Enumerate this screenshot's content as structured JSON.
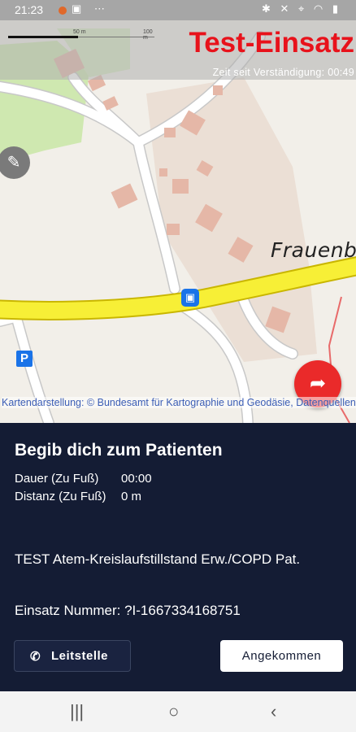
{
  "status_bar": {
    "time": "21:23",
    "left_icons": "▣ ⋯",
    "right_icons": "✱ ✕ ⌖ ◠ ▮"
  },
  "map": {
    "scale_labels": [
      "50 m",
      "100 m"
    ],
    "title": "Test-Einsatz",
    "timer": "Zeit seit Verständigung: 00:49",
    "place_label": "Frauenb",
    "attribution": "Kartendarstellung: © Bundesamt für Kartographie und Geodäsie, Datenquellen",
    "icons": {
      "edit": "pencil-icon",
      "bus": "bus-stop-icon",
      "parking": "parking-icon",
      "navigate": "directions-icon"
    }
  },
  "panel": {
    "title": "Begib dich zum Patienten",
    "duration_label": "Dauer (Zu Fuß)",
    "duration_value": "00:00",
    "distance_label": "Distanz (Zu Fuß)",
    "distance_value": "0 m",
    "description": "TEST Atem-Kreislaufstillstand Erw./COPD Pat.",
    "mission_number": "Einsatz Nummer: ?I-1667334168751",
    "button_dispatch": "Leitstelle",
    "button_arrived": "Angekommen"
  },
  "colors": {
    "title_red": "#e8121b",
    "panel_bg": "#141c34",
    "nav_button": "#ea2a2a",
    "road_yellow": "#f7ef36"
  }
}
